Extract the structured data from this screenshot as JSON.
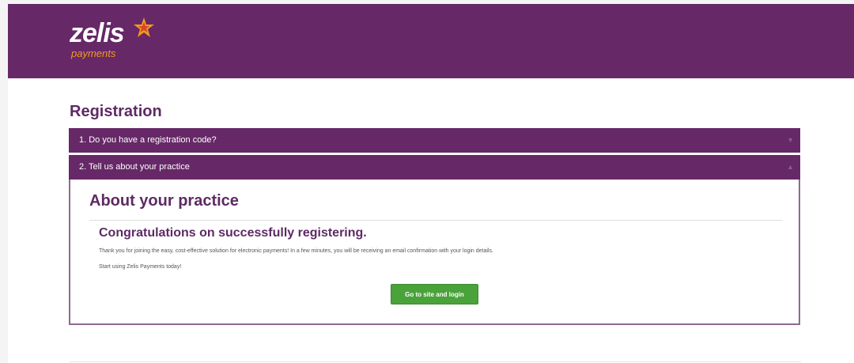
{
  "header": {
    "logo_word": "zelis",
    "logo_sub": "payments",
    "colors": {
      "brand_purple": "#662867",
      "logo_orange": "#f29a1e",
      "star_red": "#d8462a"
    }
  },
  "registration": {
    "title": "Registration",
    "steps": [
      {
        "label": "1. Do you have a registration code?",
        "caret_icon": "chevron-down-icon"
      },
      {
        "label": "2. Tell us about your practice",
        "caret_icon": "chevron-up-icon"
      }
    ]
  },
  "panel": {
    "title": "About your practice",
    "congrats": "Congratulations on successfully registering.",
    "message": "Thank you for joining the easy, cost-effective solution for electronic payments! In a few minutes, you will be receiving an email confirmation with your login details.",
    "start_text": "Start using Zelis Payments today!",
    "login_button": "Go to site and login",
    "button_color": "#4aa23a"
  }
}
